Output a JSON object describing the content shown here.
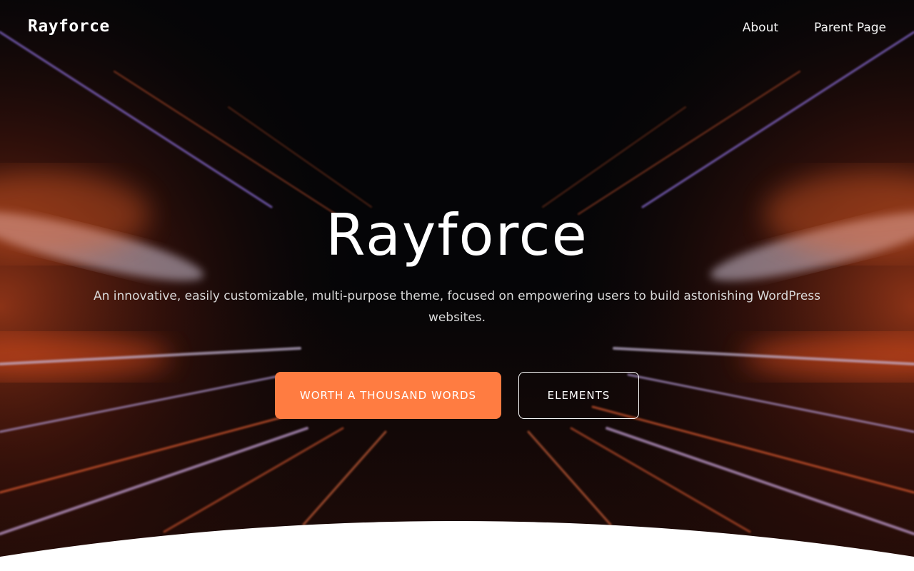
{
  "header": {
    "logo": "Rayforce",
    "nav": [
      {
        "label": "About"
      },
      {
        "label": "Parent Page"
      }
    ]
  },
  "hero": {
    "title": "Rayforce",
    "subtitle": "An innovative, easily customizable, multi-purpose theme, focused on empowering users to build astonishing WordPress websites.",
    "buttons": {
      "primary": "WORTH A THOUSAND WORDS",
      "secondary": "ELEMENTS"
    }
  },
  "colors": {
    "background": "#050507",
    "accent": "#ff7c41",
    "text": "#ffffff",
    "wave": "#ffffff"
  }
}
